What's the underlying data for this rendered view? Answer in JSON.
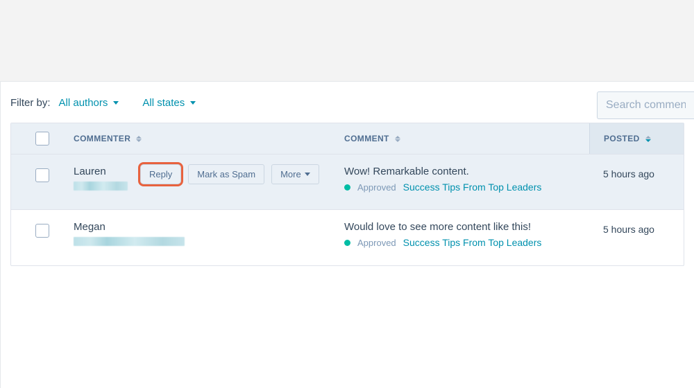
{
  "filter": {
    "label": "Filter by:",
    "authors": "All authors",
    "states": "All states"
  },
  "search": {
    "placeholder": "Search comments"
  },
  "columns": {
    "commenter": "COMMENTER",
    "comment": "COMMENT",
    "posted": "POSTED"
  },
  "actions": {
    "reply": "Reply",
    "spam": "Mark as Spam",
    "more": "More"
  },
  "rows": [
    {
      "name": "Lauren",
      "text": "Wow! Remarkable content.",
      "status": "Approved",
      "post": "Success Tips From Top Leaders",
      "posted": "5 hours ago"
    },
    {
      "name": "Megan",
      "text": "Would love to see more content like this!",
      "status": "Approved",
      "post": "Success Tips From Top Leaders",
      "posted": "5 hours ago"
    }
  ]
}
